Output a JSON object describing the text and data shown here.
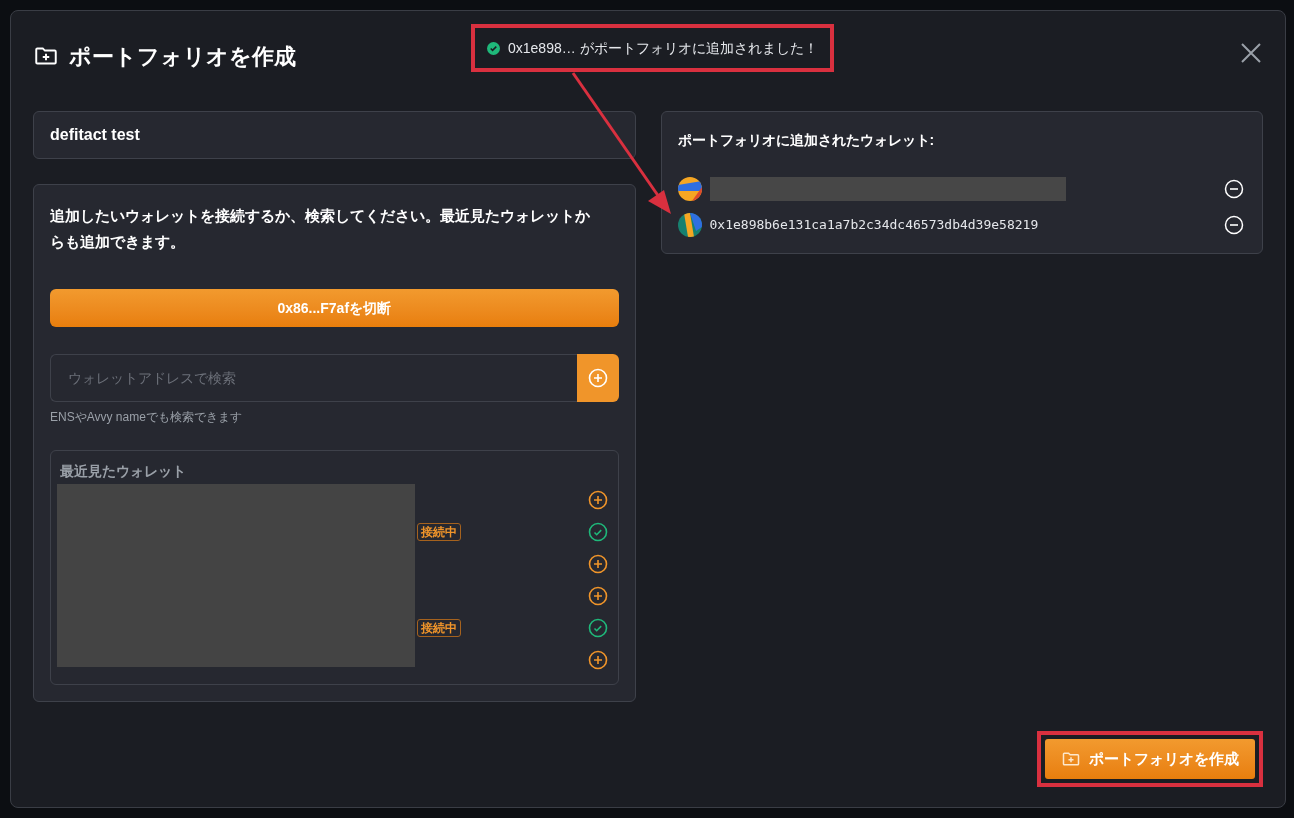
{
  "dialog": {
    "title": "ポートフォリオを作成"
  },
  "toast": {
    "message": "0x1e898… がポートフォリオに追加されました！"
  },
  "name_field": {
    "value": "defitact test"
  },
  "connect_card": {
    "instructions": "追加したいウォレットを接続するか、検索してください。最近見たウォレットからも追加できます。",
    "disconnect_button": "0x86...F7afを切断",
    "search": {
      "placeholder": "ウォレットアドレスで検索"
    },
    "hint": "ENSやAvvy nameでも検索できます"
  },
  "recent": {
    "title": "最近見たウォレット",
    "rows": [
      {
        "connected": false
      },
      {
        "connected": true,
        "badge": "接続中"
      },
      {
        "connected": false
      },
      {
        "connected": false
      },
      {
        "connected": true,
        "badge": "接続中"
      },
      {
        "connected": false
      }
    ]
  },
  "added": {
    "title": "ポートフォリオに追加されたウォレット:",
    "wallets": [
      {
        "kind": "redacted"
      },
      {
        "kind": "address",
        "address": "0x1e898b6e131ca1a7b2c34dc46573db4d39e58219"
      }
    ]
  },
  "create_button": "ポートフォリオを作成"
}
